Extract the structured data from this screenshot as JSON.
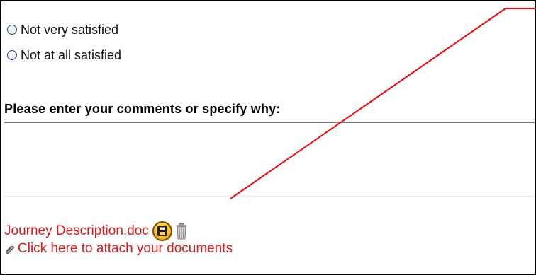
{
  "radio_options": [
    "Not very satisfied",
    "Not at all satisfied"
  ],
  "comment_label": "Please enter your comments or specify why:",
  "attachment": {
    "file_name": "Journey Description.doc",
    "attach_link": "Click here to attach your documents"
  },
  "icons": {
    "save": "save-icon",
    "trash": "trash-icon",
    "attach": "paperclip-icon"
  },
  "colors": {
    "link": "#e1191b",
    "callout": "#ff0000"
  }
}
